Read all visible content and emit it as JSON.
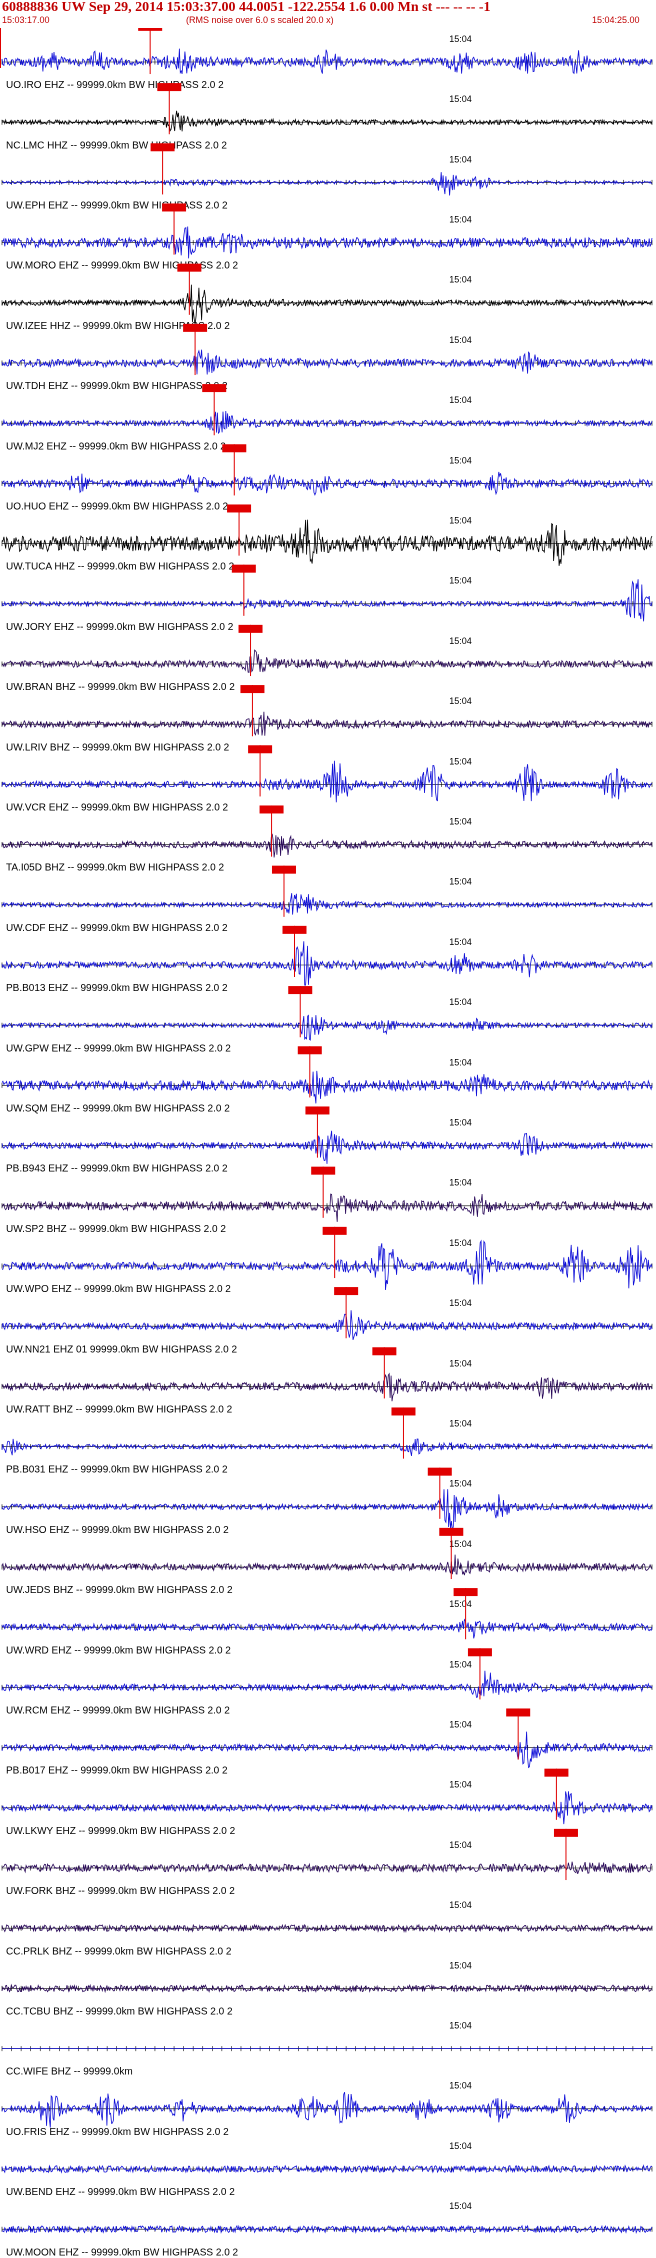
{
  "header": {
    "title": "60888836 UW Sep 29, 2014 15:03:37.00   44.0051 -122.2554  1.6 0.00 Mn st --- -- --  -1",
    "start_time": "15:03:17.00",
    "rms_note": "(RMS noise over 6.0 s scaled 20.0 x)",
    "end_time": "15:04:25.00"
  },
  "colors": {
    "blue": "#1010d8",
    "black": "#000000",
    "purple": "#2a0a5a",
    "pick": "#e00000",
    "header": "#c00000"
  },
  "chart_data": {
    "type": "line",
    "title": "60888836 UW Sep 29, 2014 15:03:37.00   44.0051 -122.2554  1.6 0.00 Mn st --- -- --  -1",
    "xlim": [
      "15:03:17.00",
      "15:04:25.00"
    ],
    "time_marker": "15:04",
    "series": [
      {
        "name": "UO.IRO EHZ -- 99999.0km BW  HIGHPASS  2.0  2",
        "color": "blue",
        "pick": 15.5,
        "amp": 0.35,
        "bursts": [
          [
            5,
            0.8
          ],
          [
            10,
            0.7
          ],
          [
            19,
            0.9
          ],
          [
            34,
            0.9
          ],
          [
            48,
            0.8
          ],
          [
            55,
            0.9
          ],
          [
            60,
            0.8
          ]
        ]
      },
      {
        "name": "NC.LMC HHZ -- 99999.0km BW  HIGHPASS  2.0  2",
        "color": "black",
        "pick": 17.5,
        "amp": 0.2,
        "bursts": [
          [
            18,
            0.8
          ]
        ]
      },
      {
        "name": "UW.EPH EHZ -- 99999.0km BW  HIGHPASS  2.0  2",
        "color": "blue",
        "pick": 16.8,
        "amp": 0.12,
        "bursts": [
          [
            46.5,
            1.3
          ],
          [
            50,
            0.6
          ]
        ]
      },
      {
        "name": "UW.MORO EHZ -- 99999.0km BW  HIGHPASS  2.0  2",
        "color": "blue",
        "pick": 18.0,
        "amp": 0.45,
        "bursts": [
          [
            19,
            1.0
          ],
          [
            24,
            0.6
          ]
        ]
      },
      {
        "name": "UW.IZEE HHZ -- 99999.0km BW  HIGHPASS  2.0  2",
        "color": "black",
        "pick": 19.6,
        "amp": 0.25,
        "bursts": [
          [
            20.3,
            1.6
          ]
        ]
      },
      {
        "name": "UW.TDH EHZ -- 99999.0km BW  HIGHPASS  2.0  2",
        "color": "blue",
        "pick": 20.2,
        "amp": 0.35,
        "bursts": [
          [
            21,
            0.8
          ],
          [
            55,
            0.8
          ]
        ]
      },
      {
        "name": "UW.MJ2 EHZ -- 99999.0km BW  HIGHPASS  2.0  2",
        "color": "blue",
        "pick": 22.2,
        "amp": 0.25,
        "bursts": [
          [
            22.8,
            1.0
          ]
        ]
      },
      {
        "name": "UO.HUO EHZ -- 99999.0km BW  HIGHPASS  2.0  2",
        "color": "blue",
        "pick": 24.3,
        "amp": 0.35,
        "bursts": [
          [
            8,
            0.6
          ],
          [
            20,
            0.6
          ],
          [
            28,
            0.8
          ],
          [
            33,
            0.8
          ],
          [
            52,
            0.7
          ]
        ]
      },
      {
        "name": "UW.TUCA HHZ -- 99999.0km BW  HIGHPASS  2.0  2",
        "color": "black",
        "pick": 24.8,
        "amp": 0.7,
        "bursts": [
          [
            32,
            1.6
          ],
          [
            58,
            1.5
          ]
        ]
      },
      {
        "name": "UW.JORY EHZ -- 99999.0km BW  HIGHPASS  2.0  2",
        "color": "blue",
        "pick": 25.3,
        "amp": 0.2,
        "bursts": [
          [
            66.5,
            2.3
          ]
        ]
      },
      {
        "name": "UW.BRAN BHZ -- 99999.0km BW  HIGHPASS  2.0  2",
        "color": "purple",
        "pick": 26.0,
        "amp": 0.3,
        "bursts": [
          [
            26.5,
            0.8
          ]
        ]
      },
      {
        "name": "UW.LRIV BHZ -- 99999.0km BW  HIGHPASS  2.0  2",
        "color": "purple",
        "pick": 26.2,
        "amp": 0.3,
        "bursts": [
          [
            27,
            0.8
          ]
        ]
      },
      {
        "name": "UW.VCR EHZ -- 99999.0km BW  HIGHPASS  2.0  2",
        "color": "blue",
        "pick": 27.0,
        "amp": 0.3,
        "bursts": [
          [
            35,
            2.2
          ],
          [
            45,
            1.6
          ],
          [
            55,
            1.7
          ],
          [
            64,
            1.4
          ]
        ]
      },
      {
        "name": "TA.I05D BHZ -- 99999.0km BW  HIGHPASS  2.0  2",
        "color": "purple",
        "pick": 28.2,
        "amp": 0.3,
        "bursts": [
          [
            29,
            0.9
          ]
        ]
      },
      {
        "name": "UW.CDF EHZ -- 99999.0km BW  HIGHPASS  2.0  2",
        "color": "blue",
        "pick": 29.5,
        "amp": 0.2,
        "bursts": [
          [
            30,
            0.7
          ],
          [
            32,
            0.7
          ]
        ]
      },
      {
        "name": "PB.B013 EHZ -- 99999.0km BW  HIGHPASS  2.0  2",
        "color": "blue",
        "pick": 30.6,
        "amp": 0.3,
        "bursts": [
          [
            31.5,
            1.7
          ],
          [
            48,
            0.9
          ],
          [
            55,
            1.0
          ]
        ]
      },
      {
        "name": "UW.GPW EHZ -- 99999.0km BW  HIGHPASS  2.0  2",
        "color": "blue",
        "pick": 31.2,
        "amp": 0.2,
        "bursts": [
          [
            32.2,
            1.2
          ],
          [
            40,
            0.5
          ],
          [
            50,
            0.5
          ]
        ]
      },
      {
        "name": "UW.SQM EHZ -- 99999.0km BW  HIGHPASS  2.0  2",
        "color": "blue",
        "pick": 32.2,
        "amp": 0.45,
        "bursts": [
          [
            33,
            1.1
          ],
          [
            50,
            0.7
          ]
        ]
      },
      {
        "name": "PB.B943 EHZ -- 99999.0km BW  HIGHPASS  2.0  2",
        "color": "blue",
        "pick": 33.0,
        "amp": 0.3,
        "bursts": [
          [
            34,
            1.7
          ],
          [
            55,
            1.0
          ]
        ]
      },
      {
        "name": "UW.SP2 BHZ -- 99999.0km BW  HIGHPASS  2.0  2",
        "color": "purple",
        "pick": 33.6,
        "amp": 0.4,
        "bursts": [
          [
            35,
            0.9
          ],
          [
            50,
            0.7
          ]
        ]
      },
      {
        "name": "UW.WPO EHZ -- 99999.0km BW  HIGHPASS  2.0  2",
        "color": "blue",
        "pick": 34.8,
        "amp": 0.35,
        "bursts": [
          [
            40,
            2.2
          ],
          [
            50,
            2.3
          ],
          [
            60,
            2.2
          ],
          [
            66,
            2.0
          ]
        ]
      },
      {
        "name": "UW.NN21 EHZ 01 99999.0km BW  HIGHPASS  2.0  2",
        "color": "blue",
        "pick": 36.0,
        "amp": 0.3,
        "bursts": [
          [
            36.5,
            1.2
          ]
        ]
      },
      {
        "name": "UW.RATT BHZ -- 99999.0km BW  HIGHPASS  2.0  2",
        "color": "purple",
        "pick": 40.0,
        "amp": 0.35,
        "bursts": [
          [
            40.5,
            0.9
          ],
          [
            57,
            1.0
          ]
        ]
      },
      {
        "name": "PB.B031 EHZ -- 99999.0km BW  HIGHPASS  2.0  2",
        "color": "blue",
        "pick": 42.0,
        "amp": 0.2,
        "bursts": [
          [
            1,
            0.6
          ],
          [
            43,
            0.6
          ]
        ]
      },
      {
        "name": "UW.HSO EHZ -- 99999.0km BW  HIGHPASS  2.0  2",
        "color": "blue",
        "pick": 45.8,
        "amp": 0.25,
        "bursts": [
          [
            47,
            2.0
          ],
          [
            52,
            0.8
          ]
        ]
      },
      {
        "name": "UW.JEDS BHZ -- 99999.0km BW  HIGHPASS  2.0  2",
        "color": "purple",
        "pick": 47.0,
        "amp": 0.3,
        "bursts": [
          [
            47.5,
            0.6
          ]
        ]
      },
      {
        "name": "UW.WRD EHZ -- 99999.0km BW  HIGHPASS  2.0  2",
        "color": "blue",
        "pick": 48.5,
        "amp": 0.3,
        "bursts": [
          [
            49,
            0.6
          ]
        ]
      },
      {
        "name": "UW.RCM EHZ -- 99999.0km BW  HIGHPASS  2.0  2",
        "color": "blue",
        "pick": 50.0,
        "amp": 0.3,
        "bursts": [
          [
            50.5,
            1.2
          ]
        ]
      },
      {
        "name": "PB.B017 EHZ -- 99999.0km BW  HIGHPASS  2.0  2",
        "color": "blue",
        "pick": 54.0,
        "amp": 0.3,
        "bursts": [
          [
            55,
            1.3
          ]
        ]
      },
      {
        "name": "UW.LKWY EHZ -- 99999.0km BW  HIGHPASS  2.0  2",
        "color": "blue",
        "pick": 58.0,
        "amp": 0.3,
        "bursts": [
          [
            59,
            1.1
          ]
        ]
      },
      {
        "name": "UW.FORK BHZ -- 99999.0km BW  HIGHPASS  2.0  2",
        "color": "purple",
        "pick": 59.0,
        "amp": 0.35,
        "bursts": []
      },
      {
        "name": "CC.PRLK BHZ -- 99999.0km BW  HIGHPASS  2.0  2",
        "color": "purple",
        "pick": null,
        "amp": 0.3,
        "bursts": []
      },
      {
        "name": "CC.TCBU BHZ -- 99999.0km BW  HIGHPASS  2.0  2",
        "color": "purple",
        "pick": null,
        "amp": 0.3,
        "bursts": []
      },
      {
        "name": "CC.WIFE BHZ -- 99999.0km",
        "color": "blue",
        "pick": null,
        "amp": 0.0,
        "bursts": []
      },
      {
        "name": "UO.FRIS EHZ -- 99999.0km BW  HIGHPASS  2.0  2",
        "color": "blue",
        "pick": null,
        "amp": 0.3,
        "bursts": [
          [
            5,
            1.6
          ],
          [
            11,
            1.4
          ],
          [
            19,
            0.9
          ],
          [
            32,
            1.2
          ],
          [
            36,
            1.4
          ],
          [
            44,
            0.9
          ],
          [
            52,
            1.1
          ],
          [
            59,
            1.1
          ]
        ]
      },
      {
        "name": "UW.BEND EHZ -- 99999.0km BW  HIGHPASS  2.0  2",
        "color": "blue",
        "pick": null,
        "amp": 0.3,
        "bursts": []
      },
      {
        "name": "UW.MOON EHZ -- 99999.0km BW  HIGHPASS  2.0  2",
        "color": "blue",
        "pick": null,
        "amp": 0.3,
        "bursts": []
      }
    ]
  }
}
